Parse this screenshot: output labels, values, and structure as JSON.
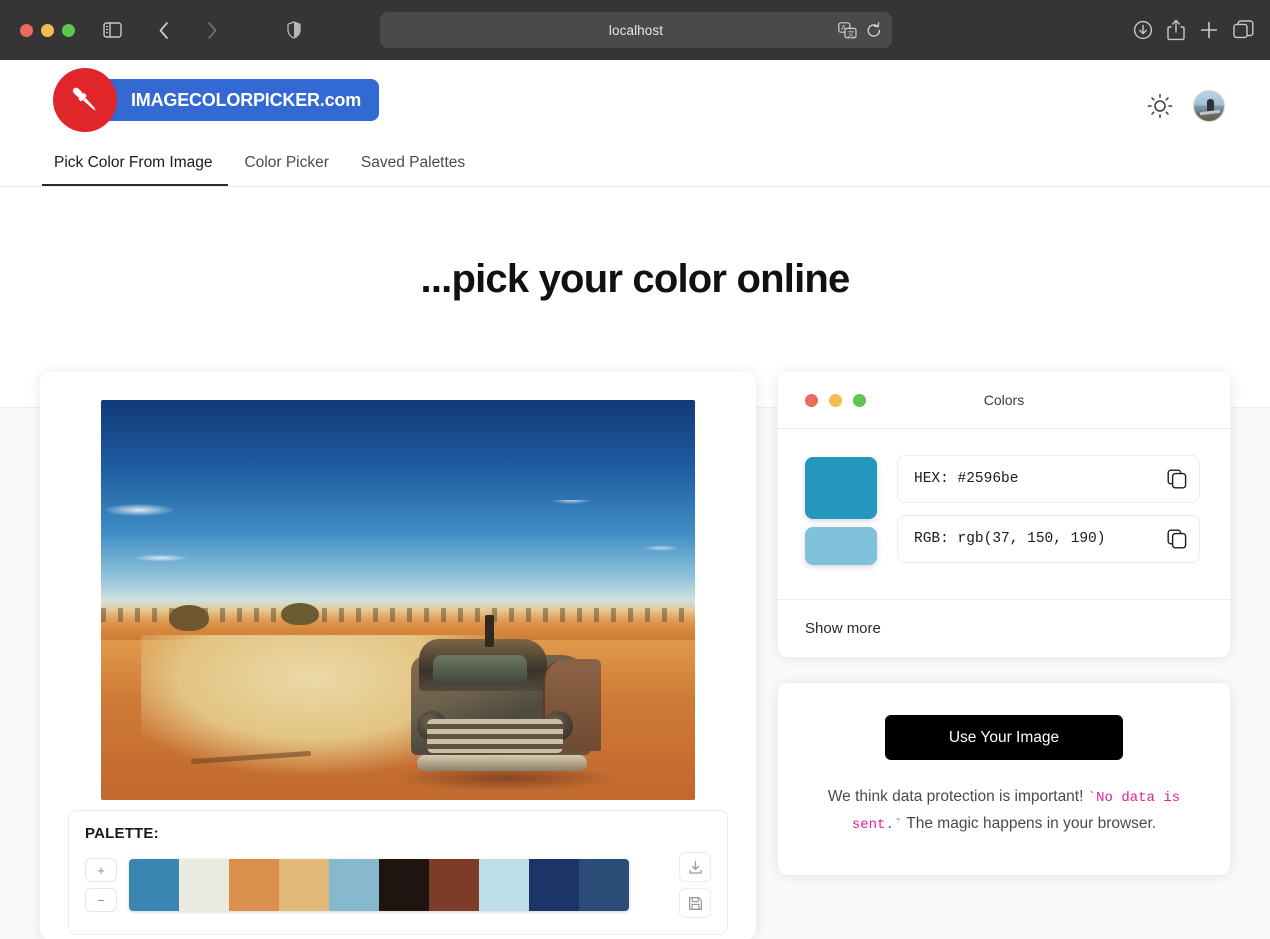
{
  "browser": {
    "url": "localhost",
    "traffic_lights": [
      "close",
      "minimize",
      "maximize"
    ],
    "icons": {
      "sidebar": "sidebar-icon",
      "back": "back-arrow-icon",
      "forward": "forward-arrow-icon",
      "shield": "privacy-shield-icon",
      "translate": "translate-icon",
      "reload": "reload-icon",
      "downloads": "downloads-icon",
      "share": "share-icon",
      "new_tab": "plus-icon",
      "tab_overview": "tab-overview-icon"
    }
  },
  "site": {
    "logo_text": "IMAGECOLORPICKER.com",
    "logo_badge_color": "#3269d3",
    "logo_circle_color": "#e0262b",
    "theme_toggle": "sun-icon",
    "avatar": "user-avatar"
  },
  "tabs": [
    {
      "label": "Pick Color From Image",
      "active": true
    },
    {
      "label": "Color Picker",
      "active": false
    },
    {
      "label": "Saved Palettes",
      "active": false
    }
  ],
  "hero": {
    "title": "...pick your color online"
  },
  "image_panel": {
    "photo_alt": "rusted car wreck in desert",
    "palette_label": "PALETTE:",
    "increase_label": "+",
    "decrease_label": "−",
    "download_icon": "download-icon",
    "save_icon": "save-floppy-icon",
    "palette_colors": [
      "#3b85b2",
      "#ebeae1",
      "#da8f4d",
      "#e1b878",
      "#86b9ce",
      "#1f140f",
      "#7d3c27",
      "#bcdee8",
      "#1c3569",
      "#2b4c77"
    ]
  },
  "colors_panel": {
    "window_title": "Colors",
    "traffic_lights": [
      "#ed6a5e",
      "#f4bd4f",
      "#61c554"
    ],
    "selected_color": "#2596be",
    "secondary_color": "#7fc0db",
    "fields": [
      {
        "label": "HEX:",
        "value": "#2596be",
        "copy_icon": "copy-icon"
      },
      {
        "label": "RGB:",
        "value": "rgb(37, 150, 190)",
        "copy_icon": "copy-icon"
      }
    ],
    "show_more_label": "Show more"
  },
  "use_image_panel": {
    "button_label": "Use Your Image",
    "privacy_prefix": "We think data protection is important! ",
    "privacy_code": "`No data is sent.`",
    "privacy_suffix": " The magic happens in your browser.",
    "code_color": "#e0219a"
  }
}
